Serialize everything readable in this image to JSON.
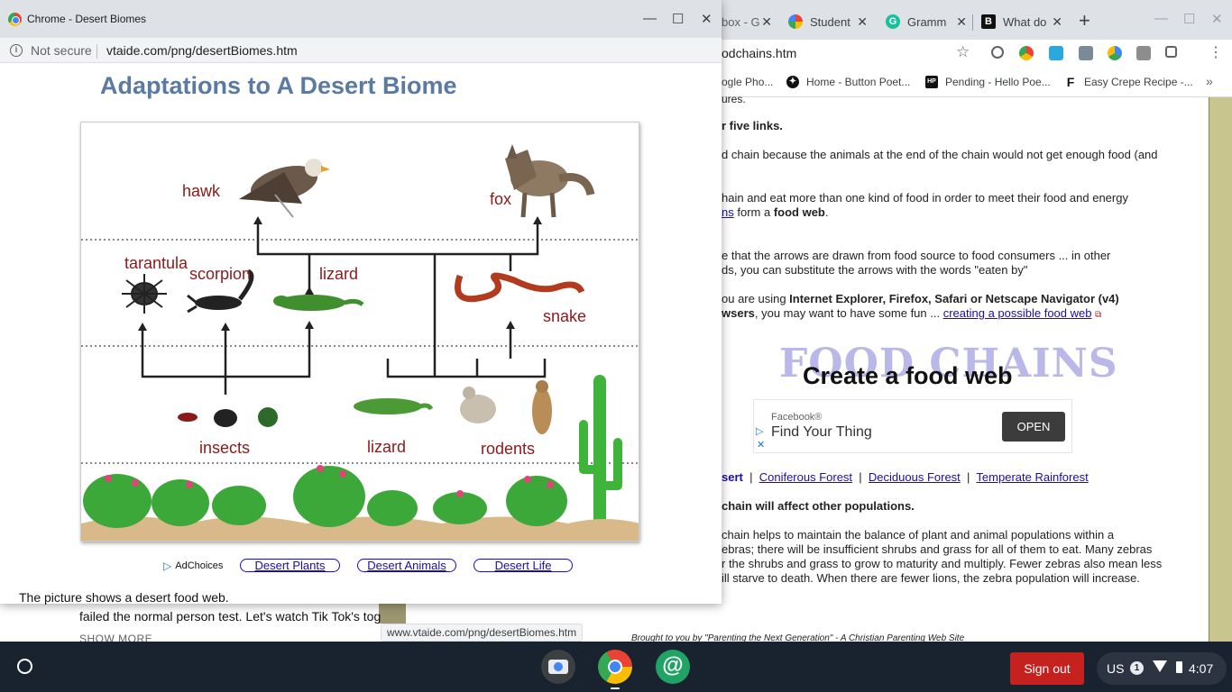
{
  "background_browser": {
    "tabs": [
      {
        "label": "box - G",
        "icon_color": "#ea4335"
      },
      {
        "label": "Student",
        "icon_color": "#a142f4"
      },
      {
        "label": "Gramm",
        "icon_color": "#15c39a"
      },
      {
        "label": "What do",
        "icon_color": "#111111"
      }
    ],
    "url_fragment": "odchains.htm",
    "bookmarks": [
      {
        "label": "ogle Pho...",
        "icon_color": ""
      },
      {
        "label": "Home - Button Poet...",
        "icon_color": "#111111"
      },
      {
        "label": "Pending - Hello Poe...",
        "icon_color": "#111111"
      },
      {
        "label": "Easy Crepe Recipe -...",
        "icon_color": "#111111"
      }
    ],
    "page": {
      "line_top": "ures.",
      "heading_links": "r five links.",
      "p1_a": "d chain because the animals at the end of the chain would not get enough food (and",
      "p2_a": "hain and eat more than one kind of food in order to meet their food and energy",
      "p2_link": "ns",
      "p2_b": " form a ",
      "p2_bold": "food web",
      "p2_end": ".",
      "p3_a": "e that the arrows are drawn from food source to food consumers ... in other",
      "p3_b": "ds, you can substitute the arrows with the words \"eaten by\"",
      "p4_a": "ou are using ",
      "p4_bold": "Internet Explorer, Firefox, Safari or Netscape Navigator (v4)",
      "p4_b_bold": "wsers",
      "p4_b": ", you may want to have some fun ... ",
      "p4_link": "creating a possible food web",
      "banner_bg_text": "FOOD CHAINS",
      "banner_text": "Create a food web",
      "ad": {
        "brand": "Facebook®",
        "headline": "Find Your Thing",
        "button": "OPEN"
      },
      "biome_links_prefix": "sert",
      "biome_links": [
        "Coniferous Forest",
        "Deciduous Forest",
        "Temperate Rainforest"
      ],
      "separator": "|",
      "heading_affect": "chain will affect other populations.",
      "para_lines": [
        "chain helps to maintain the balance of plant and animal populations within a",
        "ebras; there will be insufficient shrubs and grass for all of them to eat. Many zebras",
        "r the shrubs and grass to grow to maturity and multiply. Fewer zebras also mean less",
        "ill starve to death. When there are fewer lions, the zebra population will increase."
      ],
      "credit": "Brought to you by \"Parenting the Next Generation\" - A Christian Parenting Web Site"
    },
    "yt_text": "failed the normal person test. Let's watch Tik Tok's tog",
    "yt_more": "SHOW MORE",
    "status_url": "www.vtaide.com/png/desertBiomes.htm"
  },
  "popup": {
    "window_title": "Chrome - Desert Biomes",
    "security": "Not secure",
    "url": "vtaide.com/png/desertBiomes.htm",
    "heading": "Adaptations to A Desert Biome",
    "food_web_labels": {
      "hawk": "hawk",
      "fox": "fox",
      "tarantula": "tarantula",
      "scorpion": "scorpion",
      "lizard_top": "lizard",
      "snake": "snake",
      "insects": "insects",
      "lizard_bottom": "lizard",
      "rodents": "rodents"
    },
    "adchoices": "AdChoices",
    "nav_links": [
      "Desert Plants",
      "Desert Animals",
      "Desert Life"
    ],
    "caption": "The picture shows a desert food web."
  },
  "shelf": {
    "signout": "Sign out",
    "ime": "US",
    "notifications": "1",
    "time": "4:07"
  }
}
